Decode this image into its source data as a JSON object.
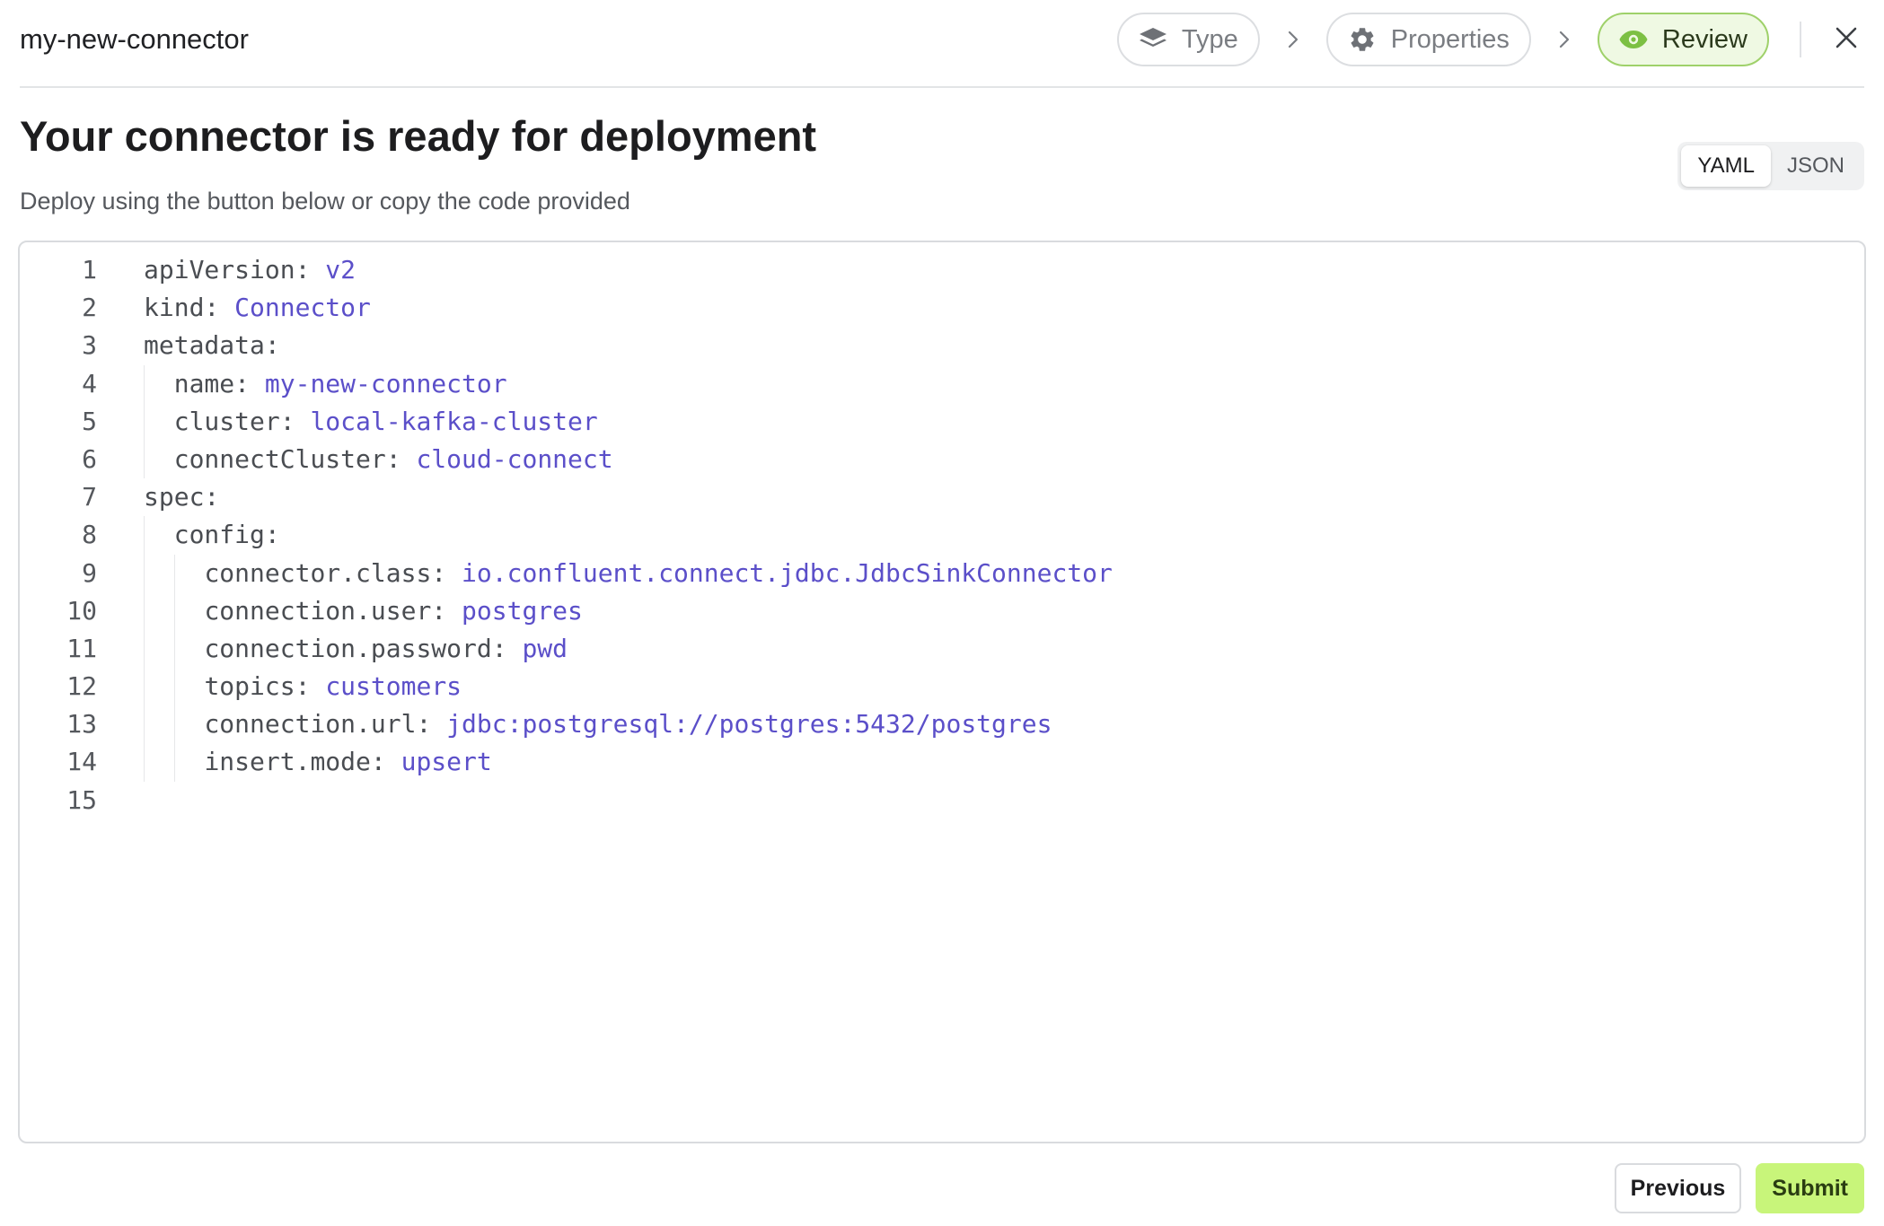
{
  "header": {
    "connector_name": "my-new-connector",
    "steps": [
      {
        "label": "Type",
        "icon": "layers-icon",
        "state": "complete"
      },
      {
        "label": "Properties",
        "icon": "gear-icon",
        "state": "complete"
      },
      {
        "label": "Review",
        "icon": "eye-icon",
        "state": "active"
      }
    ],
    "close_icon": "close-icon"
  },
  "main": {
    "title": "Your connector is ready for deployment",
    "subtitle": "Deploy using the button below or copy the code provided",
    "format_toggle": {
      "options": [
        "YAML",
        "JSON"
      ],
      "selected": "YAML"
    }
  },
  "code": {
    "language": "yaml",
    "lines": [
      {
        "number": "1",
        "indent": 0,
        "key": "apiVersion:",
        "value": "v2"
      },
      {
        "number": "2",
        "indent": 0,
        "key": "kind:",
        "value": "Connector"
      },
      {
        "number": "3",
        "indent": 0,
        "key": "metadata:",
        "value": ""
      },
      {
        "number": "4",
        "indent": 1,
        "key": "name:",
        "value": "my-new-connector"
      },
      {
        "number": "5",
        "indent": 1,
        "key": "cluster:",
        "value": "local-kafka-cluster"
      },
      {
        "number": "6",
        "indent": 1,
        "key": "connectCluster:",
        "value": "cloud-connect"
      },
      {
        "number": "7",
        "indent": 0,
        "key": "spec:",
        "value": ""
      },
      {
        "number": "8",
        "indent": 1,
        "key": "config:",
        "value": ""
      },
      {
        "number": "9",
        "indent": 2,
        "key": "connector.class:",
        "value": "io.confluent.connect.jdbc.JdbcSinkConnector"
      },
      {
        "number": "10",
        "indent": 2,
        "key": "connection.user:",
        "value": "postgres"
      },
      {
        "number": "11",
        "indent": 2,
        "key": "connection.password:",
        "value": "pwd"
      },
      {
        "number": "12",
        "indent": 2,
        "key": "topics:",
        "value": "customers"
      },
      {
        "number": "13",
        "indent": 2,
        "key": "connection.url:",
        "value": "jdbc:postgresql://postgres:5432/postgres"
      },
      {
        "number": "14",
        "indent": 2,
        "key": "insert.mode:",
        "value": "upsert"
      },
      {
        "number": "15",
        "indent": 0,
        "key": "",
        "value": ""
      }
    ]
  },
  "footer": {
    "previous_label": "Previous",
    "submit_label": "Submit"
  },
  "colors": {
    "accent_green": "#9fd16a",
    "submit_green": "#c8f57a",
    "code_value": "#5b4fc9",
    "code_key": "#4a4d52"
  }
}
